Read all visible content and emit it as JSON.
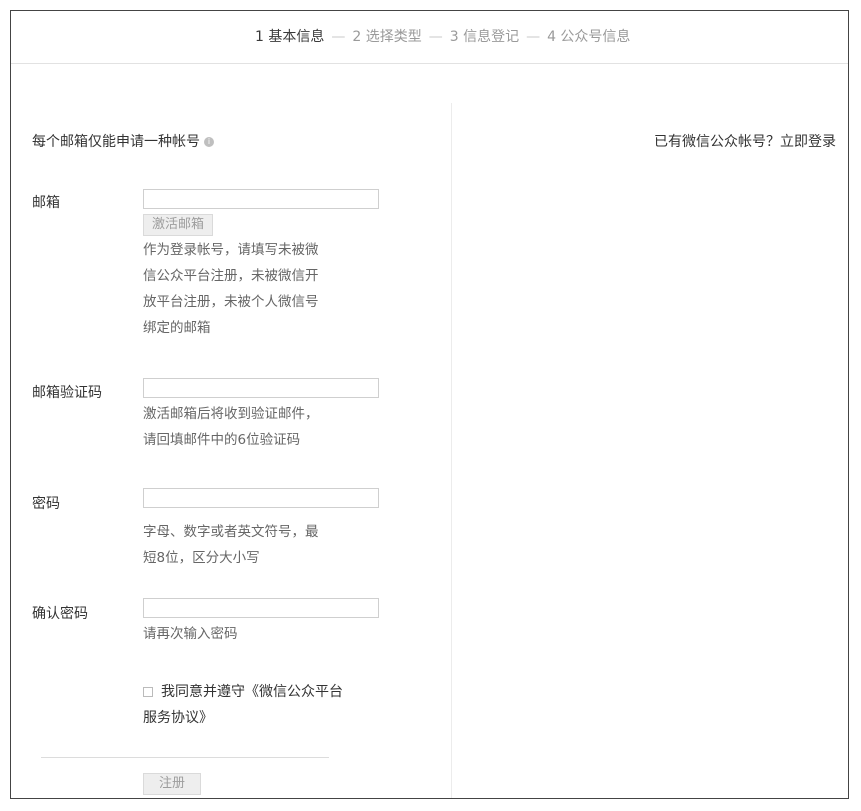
{
  "steps": [
    {
      "label": "1 基本信息",
      "active": true
    },
    {
      "label": "2 选择类型",
      "active": false
    },
    {
      "label": "3 信息登记",
      "active": false
    },
    {
      "label": "4 公众号信息",
      "active": false
    }
  ],
  "step_separator": "—",
  "form": {
    "notice": "每个邮箱仅能申请一种帐号",
    "email": {
      "label": "邮箱",
      "value": "",
      "activate_button": "激活邮箱",
      "hint_lines": [
        "作为登录帐号，请填写未被微",
        "信公众平台注册，未被微信开",
        "放平台注册，未被个人微信号",
        "绑定的邮箱"
      ]
    },
    "code": {
      "label": "邮箱验证码",
      "value": "",
      "hint_lines": [
        "激活邮箱后将收到验证邮件，",
        "请回填邮件中的6位验证码"
      ]
    },
    "password": {
      "label": "密码",
      "value": "",
      "hint_lines": [
        "字母、数字或者英文符号，最",
        "短8位，区分大小写"
      ]
    },
    "confirm": {
      "label": "确认密码",
      "value": "",
      "hint": "请再次输入密码"
    },
    "agree": {
      "text": "我同意并遵守",
      "link_line1": "《微信公众平台",
      "link_line2": "服务协议》"
    },
    "submit_label": "注册"
  },
  "login": {
    "prompt": "已有微信公众帐号？",
    "link": "立即登录"
  }
}
